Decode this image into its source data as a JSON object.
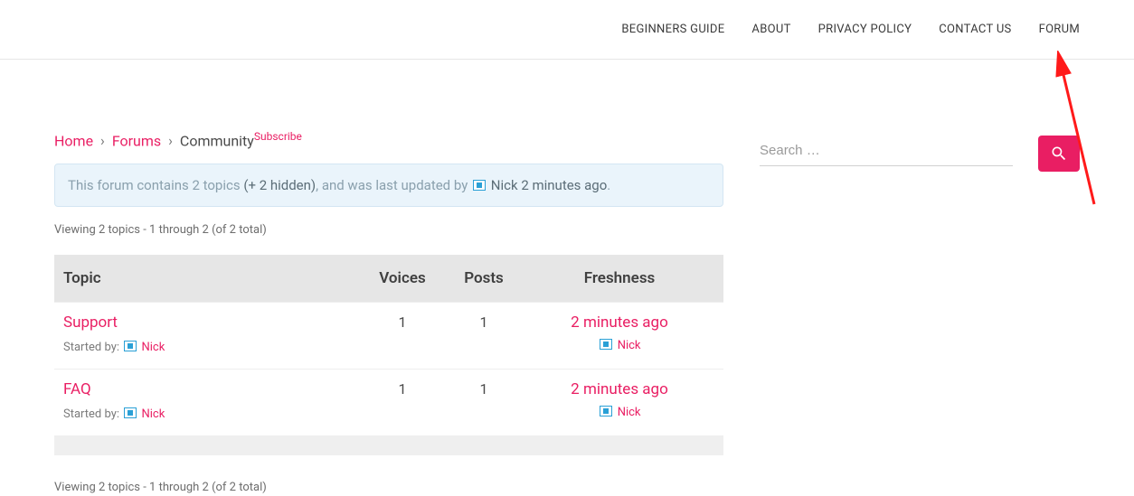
{
  "nav": {
    "items": [
      "BEGINNERS GUIDE",
      "ABOUT",
      "PRIVACY POLICY",
      "CONTACT US",
      "FORUM"
    ]
  },
  "breadcrumb": {
    "home": "Home",
    "forums": "Forums",
    "current": "Community",
    "subscribe": "Subscribe",
    "sep": "›"
  },
  "info": {
    "prefix": "This forum contains 2 topics ",
    "hidden": "(+ 2 hidden)",
    "mid": ", and was last updated by ",
    "user": "Nick",
    "time": "2 minutes ago",
    "suffix": "."
  },
  "viewing": "Viewing 2 topics - 1 through 2 (of 2 total)",
  "table": {
    "headers": {
      "topic": "Topic",
      "voices": "Voices",
      "posts": "Posts",
      "freshness": "Freshness"
    },
    "rows": [
      {
        "title": "Support",
        "started_by_label": "Started by:",
        "started_by_user": "Nick",
        "voices": "1",
        "posts": "1",
        "fresh_time": "2 minutes ago",
        "fresh_user": "Nick"
      },
      {
        "title": "FAQ",
        "started_by_label": "Started by:",
        "started_by_user": "Nick",
        "voices": "1",
        "posts": "1",
        "fresh_time": "2 minutes ago",
        "fresh_user": "Nick"
      }
    ]
  },
  "search": {
    "placeholder": "Search …"
  },
  "colors": {
    "accent": "#e91e63",
    "info_bg": "#eaf4fb"
  }
}
